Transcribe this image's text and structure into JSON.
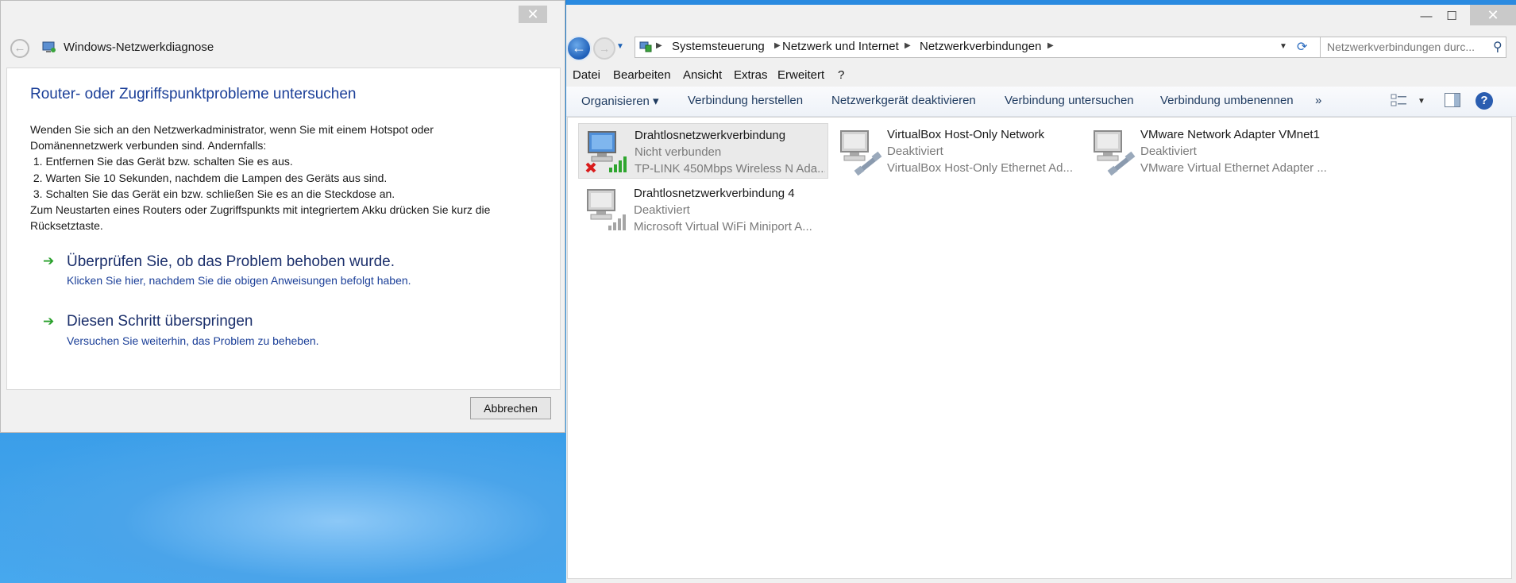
{
  "diagnose": {
    "close_glyph": "✕",
    "title": "Windows-Netzwerkdiagnose",
    "heading": "Router- oder Zugriffspunktprobleme untersuchen",
    "lines": [
      "Wenden Sie sich an den Netzwerkadministrator, wenn Sie mit einem Hotspot oder",
      "Domänennetzwerk verbunden sind. Andernfalls:",
      " 1. Entfernen Sie das Gerät bzw. schalten Sie es aus.",
      " 2. Warten Sie 10 Sekunden, nachdem die Lampen des Geräts aus sind.",
      " 3. Schalten Sie das Gerät ein bzw. schließen Sie es an die Steckdose an.",
      "Zum Neustarten eines Routers oder Zugriffspunkts mit integriertem Akku drücken Sie kurz die",
      "Rücksetztaste."
    ],
    "option1_title": "Überprüfen Sie, ob das Problem behoben wurde.",
    "option1_desc": "Klicken Sie hier, nachdem Sie die obigen Anweisungen befolgt haben.",
    "option2_title": "Diesen Schritt überspringen",
    "option2_desc": "Versuchen Sie weiterhin, das Problem zu beheben.",
    "cancel_label": "Abbrechen"
  },
  "explorer": {
    "window_controls": {
      "minimize": "—",
      "maximize": "☐",
      "close": "✕"
    },
    "breadcrumbs": [
      "Systemsteuerung",
      "Netzwerk und Internet",
      "Netzwerkverbindungen"
    ],
    "search_placeholder": "Netzwerkverbindungen durc...",
    "menu": [
      "Datei",
      "Bearbeiten",
      "Ansicht",
      "Extras",
      "Erweitert",
      "?"
    ],
    "commands": {
      "organize": "Organisieren ▾",
      "connect": "Verbindung herstellen",
      "disable": "Netzwerkgerät deaktivieren",
      "diagnose": "Verbindung untersuchen",
      "rename": "Verbindung umbenennen",
      "more": "»"
    },
    "connections": [
      {
        "name": "Drahtlosnetzwerkverbindung",
        "status": "Nicht verbunden",
        "device": "TP-LINK 450Mbps Wireless N Ada...",
        "icon": "wireless-disconnected-icon"
      },
      {
        "name": "VirtualBox Host-Only Network",
        "status": "Deaktiviert",
        "device": "VirtualBox Host-Only Ethernet Ad...",
        "icon": "ethernet-disabled-icon"
      },
      {
        "name": "VMware Network Adapter VMnet1",
        "status": "Deaktiviert",
        "device": "VMware Virtual Ethernet Adapter ...",
        "icon": "ethernet-disabled-icon"
      },
      {
        "name": "Drahtlosnetzwerkverbindung 4",
        "status": "Deaktiviert",
        "device": "Microsoft Virtual WiFi Miniport A...",
        "icon": "wireless-disabled-icon"
      }
    ]
  },
  "colors": {
    "link_green": "#29a02b",
    "heading_blue": "#1b3f98",
    "desktop_blue": "#2d93e3"
  }
}
